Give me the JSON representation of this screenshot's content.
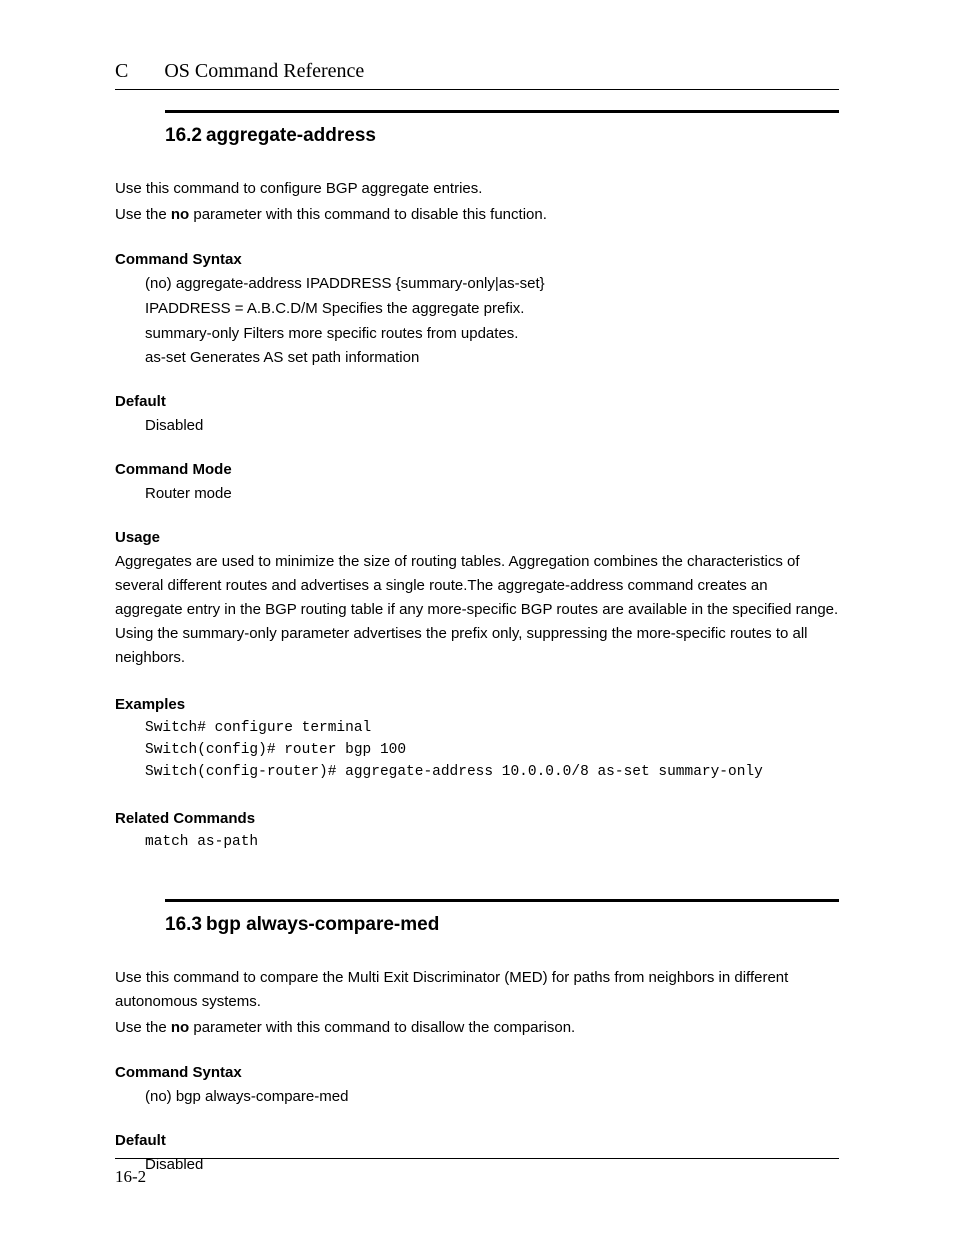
{
  "header": {
    "appendix": "C",
    "title": "OS Command Reference"
  },
  "section1": {
    "number": "16.2",
    "name": "aggregate-address",
    "intro1": "Use this command to configure BGP aggregate entries.",
    "intro2_pre": "Use the ",
    "intro2_bold": "no",
    "intro2_post": " parameter with this command to disable this function.",
    "syntax_head": "Command Syntax",
    "syntax_l1": "(no) aggregate-address IPADDRESS {summary-only|as-set}",
    "syntax_l2": "IPADDRESS = A.B.C.D/M Specifies the aggregate prefix.",
    "syntax_l3": "summary-only Filters more specific routes from updates.",
    "syntax_l4": "as-set Generates AS set path information",
    "default_head": "Default",
    "default_val": "Disabled",
    "mode_head": "Command Mode",
    "mode_val": "Router mode",
    "usage_head": "Usage",
    "usage_body": "Aggregates are used to minimize the size of routing tables. Aggregation combines the characteristics of several different routes and advertises a single route.The aggregate-address command creates an aggregate entry in the BGP routing table if any more-specific BGP routes are available in the specified range. Using the summary-only parameter advertises the prefix only, suppressing the more-specific routes to all neighbors.",
    "examples_head": "Examples",
    "examples_l1": "Switch# configure terminal",
    "examples_l2": "Switch(config)# router bgp 100",
    "examples_l3": "Switch(config-router)# aggregate-address 10.0.0.0/8 as-set summary-only",
    "related_head": "Related Commands",
    "related_l1": "match as-path"
  },
  "section2": {
    "number": "16.3",
    "name": "bgp always-compare-med",
    "intro1": "Use this command to compare the Multi Exit Discriminator (MED) for paths from neighbors in different autonomous systems.",
    "intro2_pre": "Use the ",
    "intro2_bold": "no",
    "intro2_post": " parameter with this command to disallow the comparison.",
    "syntax_head": "Command Syntax",
    "syntax_l1": "(no) bgp always-compare-med",
    "default_head": "Default",
    "default_val": "Disabled"
  },
  "footer": {
    "page": "16-2"
  }
}
